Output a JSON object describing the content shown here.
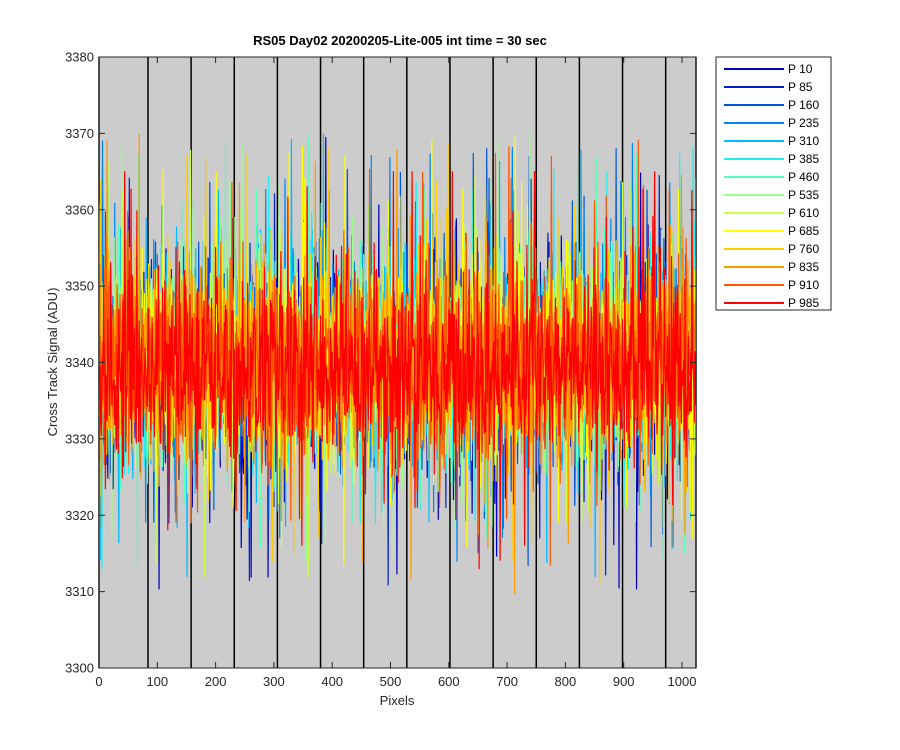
{
  "chart_data": {
    "type": "line",
    "title": "RS05 Day02 20200205-Lite-005 int time = 30 sec",
    "xlabel": "Pixels",
    "ylabel": "Cross Track Signal (ADU)",
    "xlim": [
      0,
      1024
    ],
    "ylim": [
      3300,
      3380
    ],
    "xticks": [
      0,
      100,
      200,
      300,
      400,
      500,
      600,
      700,
      800,
      900,
      1000
    ],
    "yticks": [
      3300,
      3310,
      3320,
      3330,
      3340,
      3350,
      3360,
      3370,
      3380
    ],
    "background": "#cccccc",
    "vertical_lines_x": [
      0,
      84,
      158,
      232,
      306,
      380,
      454,
      528,
      602,
      676,
      750,
      824,
      898,
      972,
      1024
    ],
    "vertical_line_color": "#000000",
    "legend_position": "outside-top-right",
    "series": [
      {
        "name": "P 10",
        "color": "#0000bb",
        "mean": 3340,
        "noise_sd": 9.0,
        "y_min": 3309,
        "y_max": 3372
      },
      {
        "name": "P 85",
        "color": "#0022cc",
        "mean": 3340,
        "noise_sd": 9.0,
        "y_min": 3310,
        "y_max": 3371
      },
      {
        "name": "P 160",
        "color": "#0055dd",
        "mean": 3340,
        "noise_sd": 9.0,
        "y_min": 3307,
        "y_max": 3368
      },
      {
        "name": "P 235",
        "color": "#0088ee",
        "mean": 3340,
        "noise_sd": 9.0,
        "y_min": 3311,
        "y_max": 3369
      },
      {
        "name": "P 310",
        "color": "#00bbff",
        "mean": 3340,
        "noise_sd": 9.0,
        "y_min": 3312,
        "y_max": 3370
      },
      {
        "name": "P 385",
        "color": "#22eeee",
        "mean": 3340,
        "noise_sd": 9.0,
        "y_min": 3313,
        "y_max": 3373
      },
      {
        "name": "P 460",
        "color": "#55ffbb",
        "mean": 3340,
        "noise_sd": 9.0,
        "y_min": 3306,
        "y_max": 3372
      },
      {
        "name": "P 535",
        "color": "#99ff88",
        "mean": 3340,
        "noise_sd": 9.0,
        "y_min": 3314,
        "y_max": 3370
      },
      {
        "name": "P 610",
        "color": "#ccff44",
        "mean": 3340,
        "noise_sd": 9.0,
        "y_min": 3312,
        "y_max": 3379
      },
      {
        "name": "P 685",
        "color": "#ffff00",
        "mean": 3340,
        "noise_sd": 9.0,
        "y_min": 3313,
        "y_max": 3372
      },
      {
        "name": "P 760",
        "color": "#ffcc00",
        "mean": 3340,
        "noise_sd": 9.0,
        "y_min": 3308,
        "y_max": 3370
      },
      {
        "name": "P 835",
        "color": "#ff9900",
        "mean": 3340,
        "noise_sd": 9.0,
        "y_min": 3309,
        "y_max": 3371
      },
      {
        "name": "P 910",
        "color": "#ff5500",
        "mean": 3340,
        "noise_sd": 9.0,
        "y_min": 3311,
        "y_max": 3370
      },
      {
        "name": "P 985",
        "color": "#ff0000",
        "mean": 3339,
        "noise_sd": 9.0,
        "y_min": 3302,
        "y_max": 3365
      }
    ]
  }
}
